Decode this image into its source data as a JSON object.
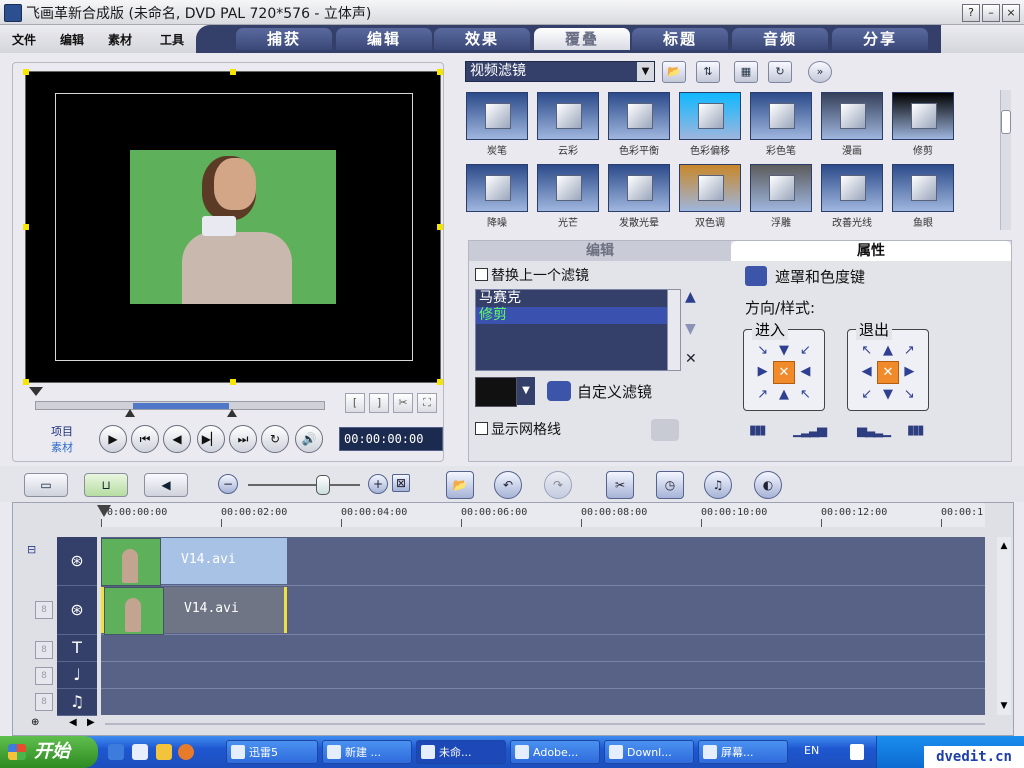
{
  "window": {
    "title": "飞画革新合成版 (未命名, DVD PAL 720*576 - 立体声)",
    "buttons": {
      "help": "?",
      "minimize": "–",
      "close": "×"
    }
  },
  "menu": [
    "文件",
    "编辑",
    "素材",
    "工具"
  ],
  "tabs": [
    "捕获",
    "编辑",
    "效果",
    "覆叠",
    "标题",
    "音频",
    "分享"
  ],
  "active_tab": "覆叠",
  "preview": {
    "mode_labels": [
      "项目",
      "素材"
    ],
    "timecode": "00:00:00:00",
    "trim_buttons": [
      "[",
      "]",
      "✂",
      "⛶"
    ],
    "transport": [
      "▶",
      "⏮",
      "◀",
      "▶▏",
      "⏭",
      "↻",
      "🔊"
    ]
  },
  "library": {
    "dropdown": "视频滤镜",
    "filters": [
      {
        "name": "炭笔",
        "accent": "#2c4b8a"
      },
      {
        "name": "云彩",
        "accent": "#2c4b8a"
      },
      {
        "name": "色彩平衡",
        "accent": "#2c4b8a"
      },
      {
        "name": "色彩偏移",
        "accent": "#0fb8ff"
      },
      {
        "name": "彩色笔",
        "accent": "#2c4b8a"
      },
      {
        "name": "漫画",
        "accent": "#35405a"
      },
      {
        "name": "修剪",
        "accent": "#000000"
      },
      {
        "name": "降噪",
        "accent": "#2c4b8a"
      },
      {
        "name": "光芒",
        "accent": "#2c4b8a"
      },
      {
        "name": "发散光晕",
        "accent": "#2c4b8a"
      },
      {
        "name": "双色调",
        "accent": "#c8872a"
      },
      {
        "name": "浮雕",
        "accent": "#5c5c5c"
      },
      {
        "name": "改善光线",
        "accent": "#2c4b8a"
      },
      {
        "name": "鱼眼",
        "accent": "#2c4b8a"
      }
    ]
  },
  "properties": {
    "tabs": [
      "编辑",
      "属性"
    ],
    "replace_checkbox": "替换上一个滤镜",
    "applied_filters": [
      "马赛克",
      "修剪"
    ],
    "selected_filter": "修剪",
    "custom_filter_label": "自定义滤镜",
    "grid_checkbox": "显示网格线",
    "mask_label": "遮罩和色度键",
    "direction_label": "方向/样式:",
    "enter_label": "进入",
    "exit_label": "退出"
  },
  "timeline": {
    "ticks": [
      "00:00:00:00",
      "00:00:02:00",
      "00:00:04:00",
      "00:00:06:00",
      "00:00:08:00",
      "00:00:10:00",
      "00:00:12:00",
      "00:00:1"
    ],
    "tracks": [
      {
        "clip": "V14.avi"
      },
      {
        "clip": "V14.avi"
      }
    ]
  },
  "taskbar": {
    "start": "开始",
    "tasks": [
      "迅雷5",
      "新建 ...",
      "未命...",
      "Adobe...",
      "Downl...",
      "屏幕..."
    ],
    "tray_lang": "EN",
    "watermark": "dvedit.cn"
  }
}
